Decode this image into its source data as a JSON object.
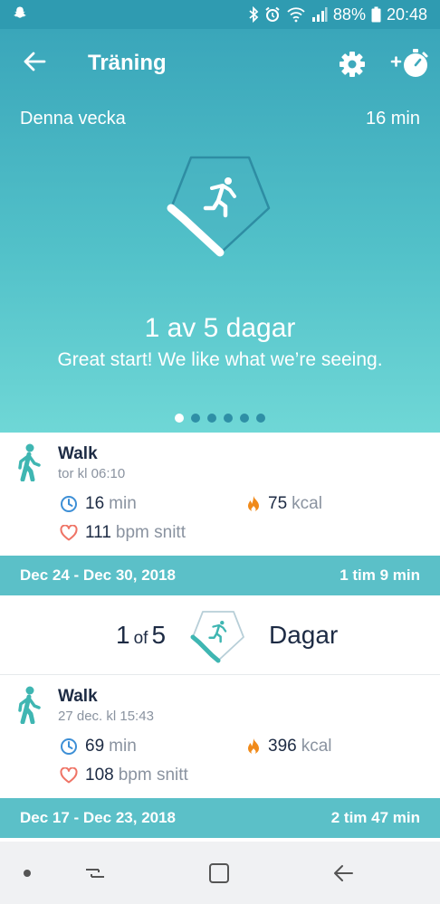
{
  "status_bar": {
    "battery": "88%",
    "time": "20:48"
  },
  "app_bar": {
    "title": "Träning"
  },
  "hero": {
    "week_label": "Denna vecka",
    "week_total": "16 min",
    "days_text": "1 av 5 dagar",
    "encourage_text": "Great start! We like what we’re seeing.",
    "progress_fraction": 0.2,
    "page_dots": 6,
    "active_dot": 0
  },
  "activities": [
    {
      "name": "Walk",
      "time": "tor kl 06:10",
      "duration_value": "16",
      "duration_unit": "min",
      "calories_value": "75",
      "calories_unit": "kcal",
      "heart_value": "111",
      "heart_unit": "bpm snitt"
    },
    {
      "name": "Walk",
      "time": "27 dec. kl 15:43",
      "duration_value": "69",
      "duration_unit": "min",
      "calories_value": "396",
      "calories_unit": "kcal",
      "heart_value": "108",
      "heart_unit": "bpm snitt"
    }
  ],
  "weeks": [
    {
      "range": "Dec 24 - Dec 30, 2018",
      "total": "1 tim 9 min"
    },
    {
      "range": "Dec 17 - Dec 23, 2018",
      "total": "2 tim 47 min"
    }
  ],
  "summary": {
    "count": "1",
    "of": "of",
    "goal": "5",
    "label": "Dagar",
    "progress_fraction": 0.2
  },
  "colors": {
    "brand": "#3aa6ba",
    "accent": "#5bc0c8",
    "walk_icon": "#3fb6b2",
    "clock": "#3d8fd6",
    "flame": "#f08a1a",
    "heart": "#ef7466"
  }
}
